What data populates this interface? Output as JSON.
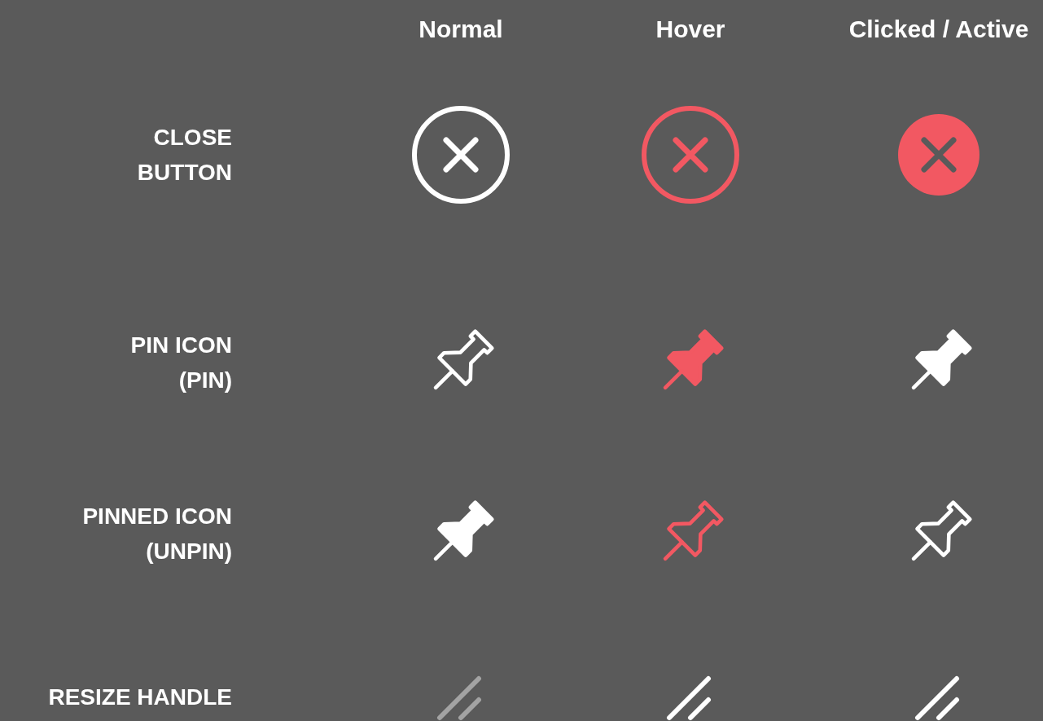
{
  "columns": [
    "Normal",
    "Hover",
    "Clicked / Active"
  ],
  "rows": [
    {
      "kind": "close",
      "label": [
        "CLOSE",
        "BUTTON"
      ],
      "states": [
        {
          "color": "#ffffff"
        },
        {
          "color": "#f25862"
        },
        {
          "color": "#f25862"
        }
      ]
    },
    {
      "kind": "pin",
      "label": [
        "PIN ICON",
        "(PIN)"
      ],
      "states": [
        {
          "color": "#ffffff"
        },
        {
          "color": "#f25862"
        },
        {
          "color": "#ffffff"
        }
      ]
    },
    {
      "kind": "pinned",
      "label": [
        "PINNED ICON",
        "(UNPIN)"
      ],
      "states": [
        {
          "color": "#ffffff"
        },
        {
          "color": "#f25862"
        },
        {
          "color": "#ffffff"
        }
      ]
    },
    {
      "kind": "resize",
      "label": [
        "RESIZE HANDLE"
      ],
      "states": [
        {
          "color": "#a3a3a3"
        },
        {
          "color": "#ffffff"
        },
        {
          "color": "#ffffff"
        }
      ]
    }
  ]
}
